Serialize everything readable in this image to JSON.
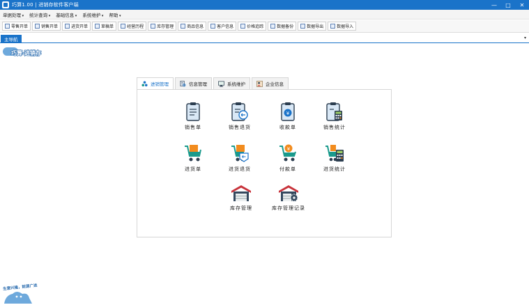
{
  "window": {
    "title": "巧算1.00 | 进销存软件客户端"
  },
  "window_controls": {
    "minimize": "—",
    "maximize": "□",
    "close": "✕"
  },
  "menu": [
    "单据处理",
    "统计查询",
    "基础信息",
    "系统维护",
    "帮助"
  ],
  "toolbar": [
    "零售开单",
    "销售开单",
    "进货开单",
    "草稿单",
    "经营历程",
    "库存管理",
    "商品信息",
    "客户信息",
    "价格追踪",
    "数据备份",
    "数据导出",
    "数据导入"
  ],
  "main_tab": {
    "label": "主导航",
    "close": "▾"
  },
  "logo": {
    "text": "巧算·进销存"
  },
  "panel_tabs": [
    {
      "label": "进销管理",
      "icon": "cluster-dots-icon"
    },
    {
      "label": "信息管理",
      "icon": "document-search-icon"
    },
    {
      "label": "系统维护",
      "icon": "monitor-icon"
    },
    {
      "label": "企业信息",
      "icon": "person-card-icon"
    }
  ],
  "features": [
    {
      "label": "销售单",
      "icon": "clipboard-icon"
    },
    {
      "label": "销售退货",
      "icon": "clipboard-return-icon"
    },
    {
      "label": "收款单",
      "icon": "clipboard-money-icon"
    },
    {
      "label": "销售统计",
      "icon": "clipboard-calculator-icon"
    },
    {
      "label": "进货单",
      "icon": "cart-icon"
    },
    {
      "label": "进货退货",
      "icon": "cart-return-icon"
    },
    {
      "label": "付款单",
      "icon": "cart-money-icon"
    },
    {
      "label": "进货统计",
      "icon": "cart-calculator-icon"
    },
    {
      "label": "库存管理",
      "icon": "warehouse-icon"
    },
    {
      "label": "库存管理记录",
      "icon": "warehouse-gear-icon"
    }
  ],
  "mascot": {
    "slogan": "生意兴隆，财源广进"
  },
  "colors": {
    "accent": "#1a73c9",
    "orange": "#f28c1e",
    "teal": "#1a9a8c",
    "red": "#c8323a"
  }
}
